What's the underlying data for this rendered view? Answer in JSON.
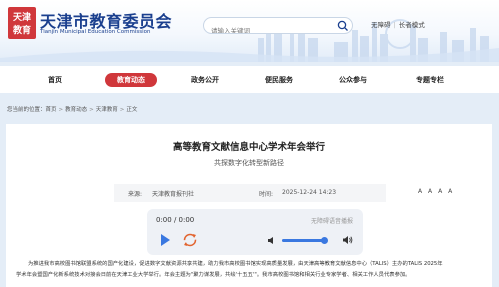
{
  "header": {
    "site_name": "天津市教育委员会",
    "site_name_en": "Tianjin Municipal Education Commission",
    "logo_text": "天津教育",
    "search_placeholder": "请输入关键词",
    "links": [
      "无障碍",
      "长者模式"
    ]
  },
  "nav": {
    "items": [
      {
        "label": "首页",
        "active": false
      },
      {
        "label": "教育动态",
        "active": true
      },
      {
        "label": "政务公开",
        "active": false
      },
      {
        "label": "便民服务",
        "active": false
      },
      {
        "label": "公众参与",
        "active": false
      },
      {
        "label": "专题专栏",
        "active": false
      }
    ]
  },
  "breadcrumb": {
    "prefix": "您当前的位置：",
    "items": [
      "首页",
      "教育动态",
      "天津教育",
      "正文"
    ]
  },
  "article": {
    "title": "高等教育文献信息中心学术年会举行",
    "subtitle": "共探数字化转型新路径",
    "source_label": "来源:",
    "source": "天津教育报刊社",
    "time_label": "时间:",
    "time": "2025-12-24 14:23",
    "tools": [
      "A",
      "A",
      "A",
      "A"
    ],
    "body": [
      "为推进我市高校图书馆联盟系统的国产化建设，促进数字文献资源共享共建，助力我市高校图书馆实现高质量发展，由天津高等教育文献信息中心（TALIS）主办的TALIS 2025年",
      "学术年会暨国产化新系统技术对接会日前在天津工业大学举行。年会主题为\"聚力谋发展，共绘'十五五'\"。我市高校图书馆和相关行业专家学者、相关工作人员代表参加。"
    ]
  },
  "audio": {
    "time": "0:00 / 0:00",
    "note": "无障碍语音播报",
    "volume": 0.92
  },
  "colors": {
    "brand": "#1a3f8e",
    "accent": "#d0373b",
    "audio_blue": "#3a78e0"
  }
}
